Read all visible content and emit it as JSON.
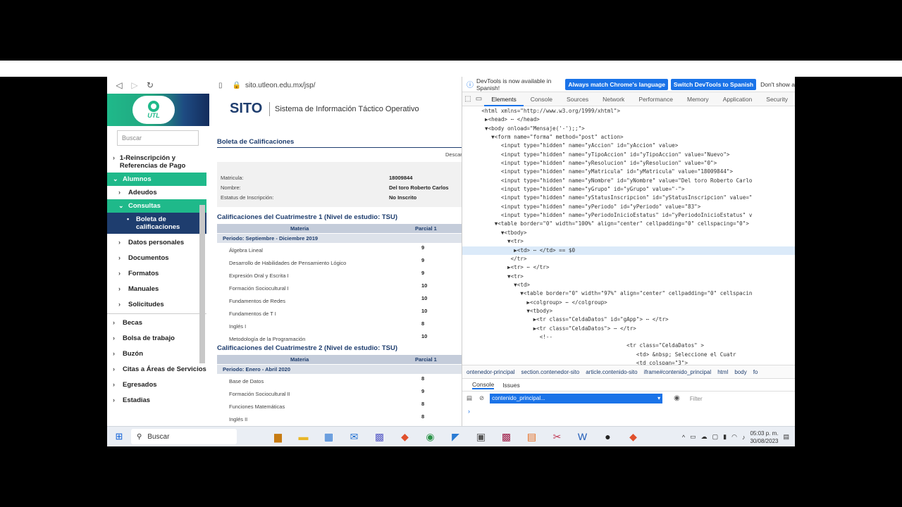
{
  "browser": {
    "url": "sito.utleon.edu.mx/jsp/"
  },
  "site": {
    "logo_text": "UTL",
    "brand": "SITO",
    "subtitle": "Sistema de Información Táctico Operativo"
  },
  "sidebar": {
    "search_placeholder": "Buscar",
    "items": [
      {
        "label": "1-Reinscripción y Referencias de Pago"
      },
      {
        "label": "Alumnos"
      },
      {
        "label": "Adeudos"
      },
      {
        "label": "Consultas"
      },
      {
        "label": "Boleta de calificaciones"
      },
      {
        "label": "Datos personales"
      },
      {
        "label": "Documentos"
      },
      {
        "label": "Formatos"
      },
      {
        "label": "Manuales"
      },
      {
        "label": "Solicitudes"
      },
      {
        "label": "Becas"
      },
      {
        "label": "Bolsa de trabajo"
      },
      {
        "label": "Buzón"
      },
      {
        "label": "Citas a Áreas de Servicios"
      },
      {
        "label": "Egresados"
      },
      {
        "label": "Estadias"
      }
    ]
  },
  "main": {
    "title": "Boleta de Calificaciones",
    "descargar": "Descar",
    "info": {
      "matricula_label": "Matricula:",
      "matricula_value": "18009844",
      "nombre_label": "Nombre:",
      "nombre_value": "Del toro Roberto Carlos",
      "estatus_label": "Estatus de Inscripción:",
      "estatus_value": "No Inscrito"
    },
    "cuatri1": {
      "title": "Calificaciones del Cuatrimestre 1 (Nivel de estudio: TSU)",
      "col_materia": "Materia",
      "col_parcial": "Parcial 1",
      "period": "Periodo: Septiembre - Diciembre 2019",
      "rows": [
        {
          "subject": "Álgebra Lineal",
          "grade": "9"
        },
        {
          "subject": "Desarrollo de Habilidades de Pensamiento Lógico",
          "grade": "9"
        },
        {
          "subject": "Expresión Oral y Escrita I",
          "grade": "9"
        },
        {
          "subject": "Formación Sociocultural I",
          "grade": "10"
        },
        {
          "subject": "Fundamentos de Redes",
          "grade": "10"
        },
        {
          "subject": "Fundamentos de T I",
          "grade": "10"
        },
        {
          "subject": "Inglés I",
          "grade": "8"
        },
        {
          "subject": "Metodología de la Programación",
          "grade": "10"
        }
      ]
    },
    "cuatri2": {
      "title": "Calificaciones del Cuatrimestre 2 (Nivel de estudio: TSU)",
      "col_materia": "Materia",
      "col_parcial": "Parcial 1",
      "period": "Periodo: Enero - Abril 2020",
      "rows": [
        {
          "subject": "Base de Datos",
          "grade": "8"
        },
        {
          "subject": "Formación Sociocultural II",
          "grade": "9"
        },
        {
          "subject": "Funciones Matemáticas",
          "grade": "8"
        },
        {
          "subject": "Inglés II",
          "grade": "8"
        }
      ]
    }
  },
  "devtools": {
    "info_text": "DevTools is now available in Spanish!",
    "btn_match": "Always match Chrome's language",
    "btn_switch": "Switch DevTools to Spanish",
    "dont_show": "Don't show a",
    "tabs": [
      "Elements",
      "Console",
      "Sources",
      "Network",
      "Performance",
      "Memory",
      "Application",
      "Security"
    ],
    "code_lines": [
      "      <html xmlns=\"http://www.w3.org/1999/xhtml\">",
      "       ▶<head> ⋯ </head>",
      "       ▼<body onload=\"Mensaje('-');;\">",
      "         ▼<form name=\"forma\" method=\"post\" action>",
      "            <input type=\"hidden\" name=\"yAccion\" id=\"yAccion\" value>",
      "            <input type=\"hidden\" name=\"yTipoAccion\" id=\"yTipoAccion\" value=\"Nuevo\">",
      "            <input type=\"hidden\" name=\"yResolucion\" id=\"yResolucion\" value=\"0\">",
      "            <input type=\"hidden\" name=\"yMatricula\" id=\"yMatricula\" value=\"18009844\">",
      "            <input type=\"hidden\" name=\"yNombre\" id=\"yNombre\" value=\"Del toro Roberto Carlo",
      "            <input type=\"hidden\" name=\"yGrupo\" id=\"yGrupo\" value=\"-\">",
      "            <input type=\"hidden\" name=\"yStatusInscripcion\" id=\"yStatusInscripcion\" value=\"",
      "            <input type=\"hidden\" name=\"yPeriodo\" id=\"yPeriodo\" value=\"83\">",
      "            <input type=\"hidden\" name=\"yPeriodoInicioEstatus\" id=\"yPeriodoInicioEstatus\" v",
      "          ▼<table border=\"0\" width=\"100%\" align=\"center\" cellpadding=\"0\" cellspacing=\"0\">",
      "            ▼<tbody>",
      "              ▼<tr>",
      "                ▶<td> ⋯ </td> == $0",
      "               </tr>",
      "              ▶<tr> ⋯ </tr>",
      "              ▼<tr>",
      "                ▼<td>",
      "                  ▼<table border=\"0\" width=\"97%\" align=\"center\" cellpadding=\"0\" cellspacin",
      "                    ▶<colgroup> ⋯ </colgroup>",
      "                    ▼<tbody>",
      "                      ▶<tr class=\"CeldaDatos\" id=\"gApp\"> ⋯ </tr>",
      "                      ▶<tr class=\"CeldaDatos\"> ⋯ </tr>",
      "                        <!--",
      "                                                   <tr class=\"CeldaDatos\" >",
      "                                                      <td> &nbsp; Seleccione el Cuatr",
      "                                                      <td colspan=\"3\">"
    ],
    "crumbs": [
      "ontenedor-principal",
      "section.contenedor-sito",
      "article.contenido-sito",
      "iframe#contenido_principal",
      "html",
      "body",
      "fo"
    ],
    "console_tabs": [
      "Console",
      "Issues"
    ],
    "context": "contenido_principal...",
    "filter_placeholder": "Filter",
    "prompt": "›"
  },
  "taskbar": {
    "search": "Buscar",
    "time": "05:03 p. m.",
    "date": "30/08/2023"
  }
}
